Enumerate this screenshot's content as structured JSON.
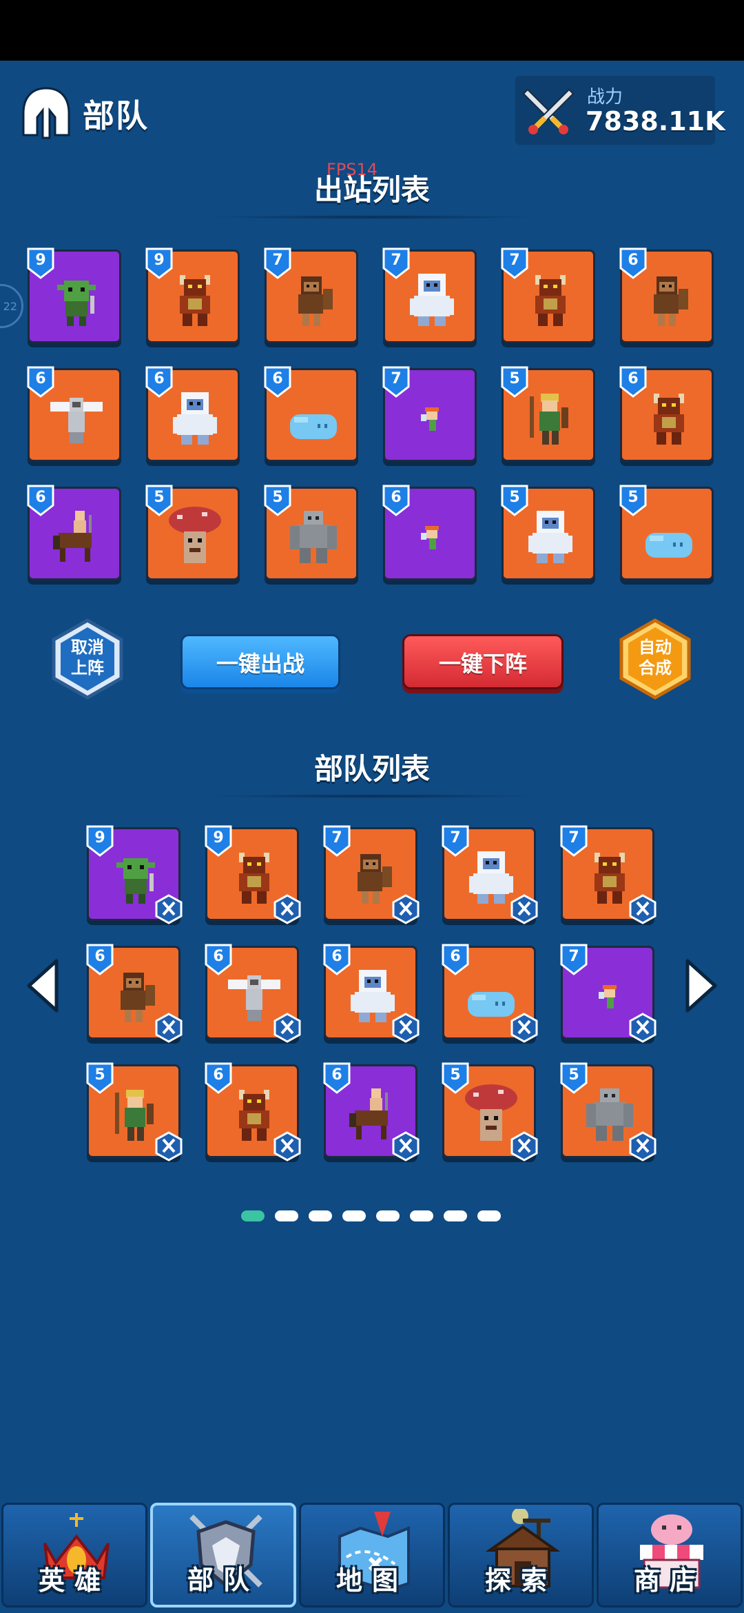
{
  "header": {
    "title": "部队",
    "power_label": "战力",
    "power_value": "7838.11K"
  },
  "debug": {
    "fps": "FPS14",
    "side_badge": "22"
  },
  "deployed": {
    "title": "出站列表",
    "cards": [
      {
        "level": "9",
        "bg": "purple",
        "unit": "goblin"
      },
      {
        "level": "9",
        "bg": "orange",
        "unit": "minotaur"
      },
      {
        "level": "7",
        "bg": "orange",
        "unit": "caveman"
      },
      {
        "level": "7",
        "bg": "orange",
        "unit": "yeti"
      },
      {
        "level": "7",
        "bg": "orange",
        "unit": "minotaur"
      },
      {
        "level": "6",
        "bg": "orange",
        "unit": "caveman"
      },
      {
        "level": "6",
        "bg": "orange",
        "unit": "angel"
      },
      {
        "level": "6",
        "bg": "orange",
        "unit": "yeti"
      },
      {
        "level": "6",
        "bg": "orange",
        "unit": "slime"
      },
      {
        "level": "7",
        "bg": "purple",
        "unit": "fairy"
      },
      {
        "level": "5",
        "bg": "orange",
        "unit": "archer"
      },
      {
        "level": "6",
        "bg": "orange",
        "unit": "minotaur"
      },
      {
        "level": "6",
        "bg": "purple",
        "unit": "centaur"
      },
      {
        "level": "5",
        "bg": "orange",
        "unit": "mushroom"
      },
      {
        "level": "5",
        "bg": "orange",
        "unit": "golem"
      },
      {
        "level": "6",
        "bg": "purple",
        "unit": "fairy"
      },
      {
        "level": "5",
        "bg": "orange",
        "unit": "yeti"
      },
      {
        "level": "5",
        "bg": "orange",
        "unit": "slime"
      }
    ]
  },
  "actions": {
    "cancel": {
      "line1": "取消",
      "line2": "上阵"
    },
    "deploy_all": "一键出战",
    "remove_all": "一键下阵",
    "auto": {
      "line1": "自动",
      "line2": "合成"
    }
  },
  "roster": {
    "title": "部队列表",
    "cards": [
      {
        "level": "9",
        "bg": "purple",
        "unit": "goblin"
      },
      {
        "level": "9",
        "bg": "orange",
        "unit": "minotaur"
      },
      {
        "level": "7",
        "bg": "orange",
        "unit": "caveman"
      },
      {
        "level": "7",
        "bg": "orange",
        "unit": "yeti"
      },
      {
        "level": "7",
        "bg": "orange",
        "unit": "minotaur"
      },
      {
        "level": "6",
        "bg": "orange",
        "unit": "caveman"
      },
      {
        "level": "6",
        "bg": "orange",
        "unit": "angel"
      },
      {
        "level": "6",
        "bg": "orange",
        "unit": "yeti"
      },
      {
        "level": "6",
        "bg": "orange",
        "unit": "slime"
      },
      {
        "level": "7",
        "bg": "purple",
        "unit": "fairy"
      },
      {
        "level": "5",
        "bg": "orange",
        "unit": "archer"
      },
      {
        "level": "6",
        "bg": "orange",
        "unit": "minotaur"
      },
      {
        "level": "6",
        "bg": "purple",
        "unit": "centaur"
      },
      {
        "level": "5",
        "bg": "orange",
        "unit": "mushroom"
      },
      {
        "level": "5",
        "bg": "orange",
        "unit": "golem"
      }
    ],
    "pages": 8,
    "current_page": 1
  },
  "nav": [
    {
      "label": "英雄",
      "icon": "crown-icon",
      "active": false
    },
    {
      "label": "部队",
      "icon": "shield-swords-icon",
      "active": true
    },
    {
      "label": "地图",
      "icon": "map-icon",
      "active": false
    },
    {
      "label": "探索",
      "icon": "cabin-icon",
      "active": false
    },
    {
      "label": "商店",
      "icon": "shop-icon",
      "active": false
    }
  ],
  "colors": {
    "bg": "#0f4a82",
    "card_orange": "#ee6a2a",
    "card_purple": "#8a2ed8",
    "level_badge": "#1e7fe6",
    "active_dot": "#3cc3a3"
  }
}
